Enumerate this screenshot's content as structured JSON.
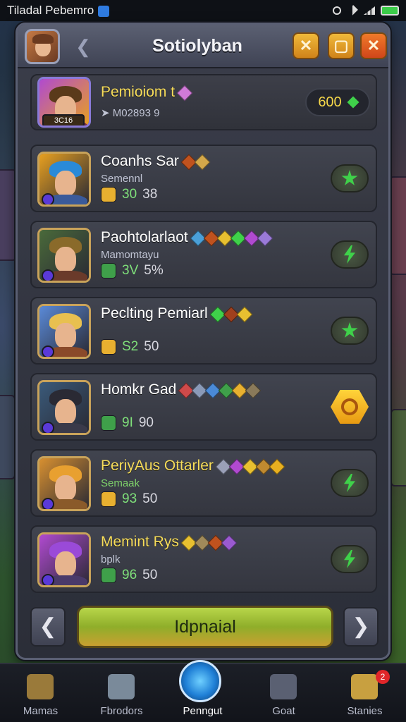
{
  "status_bar": {
    "title": "Tiladal Pebemro"
  },
  "header": {
    "title": "Sotiolyban"
  },
  "self_entry": {
    "name": "Pemioiom t",
    "level": "3C16",
    "subtitle": "M02893 9",
    "score": "600"
  },
  "players": [
    {
      "name": "Coanhs Sar",
      "subtitle": "Semennl",
      "stat_a": "30",
      "stat_b": "38",
      "action": "star",
      "gems": [
        "#c0521e",
        "#d4a84a"
      ],
      "colors": {
        "bg": "#e8a020",
        "hair": "#2a8ad8",
        "body": "#3a5a9a"
      }
    },
    {
      "name": "Paohtolarlaot",
      "subtitle": "Mamomtayu",
      "stat_a": "3V",
      "stat_b": "5%",
      "action": "bolt",
      "gems": [
        "#4aa0d8",
        "#c0521e",
        "#e8c030",
        "#3fd14a",
        "#b04ad0",
        "#9a7ad8"
      ],
      "colors": {
        "bg": "#4a6a3a",
        "hair": "#8a6a2a",
        "body": "#6a3a2a"
      }
    },
    {
      "name": "Peclting Pemiarl",
      "subtitle": "",
      "stat_a": "S2",
      "stat_b": "50",
      "action": "star",
      "gems": [
        "#3fd14a",
        "#a0401e",
        "#e8c030"
      ],
      "colors": {
        "bg": "#5a8ad8",
        "hair": "#e8c050",
        "body": "#8a4a2a"
      }
    },
    {
      "name": "Homkr Gad",
      "subtitle": "",
      "stat_a": "9I",
      "stat_b": "90",
      "action": "gold",
      "gems": [
        "#d04a4a",
        "#8a9ab8",
        "#4a8ad8",
        "#3fa04a",
        "#e8b030",
        "#8a7a5a"
      ],
      "colors": {
        "bg": "#3a5a7a",
        "hair": "#2a2a34",
        "body": "#3a3a4a"
      }
    },
    {
      "name": "PeriyAus Ottarler",
      "subtitle": "Semaak",
      "stat_a": "93",
      "stat_b": "50",
      "action": "bolt",
      "gems": [
        "#9aa0b8",
        "#b04ad0",
        "#e8c030",
        "#c08a30",
        "#e8b020"
      ],
      "colors": {
        "bg": "#d89030",
        "hair": "#e8a030",
        "body": "#8a5a2a"
      }
    },
    {
      "name": "Memint Rys",
      "subtitle": "bplk",
      "stat_a": "96",
      "stat_b": "50",
      "action": "bolt",
      "gems": [
        "#e8c030",
        "#a08a5a",
        "#c0521e",
        "#9a5ad0"
      ],
      "colors": {
        "bg": "#b04ad0",
        "hair": "#9a4ad8",
        "body": "#4a3a6a"
      }
    }
  ],
  "footer": {
    "button_label": "Idpnaial"
  },
  "bottom_nav": [
    {
      "label": "Mamas",
      "icon": "home-icon",
      "active": false
    },
    {
      "label": "Fbrodors",
      "icon": "list-icon",
      "active": false
    },
    {
      "label": "Penngut",
      "icon": "profile-icon",
      "active": true
    },
    {
      "label": "Goat",
      "icon": "camera-icon",
      "active": false
    },
    {
      "label": "Stanies",
      "icon": "ring-icon",
      "active": false,
      "badge": "2"
    }
  ]
}
